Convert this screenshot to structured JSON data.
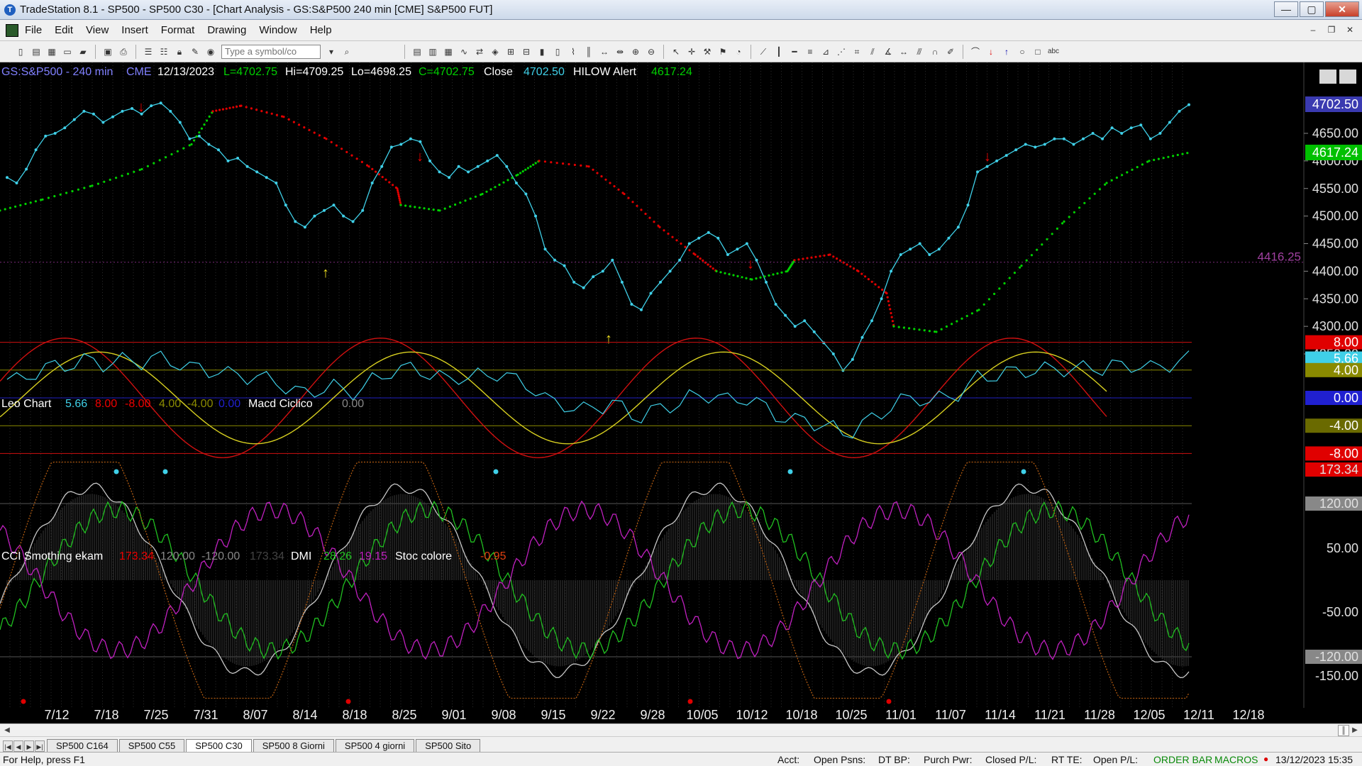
{
  "window": {
    "title": "TradeStation 8.1 - SP500 - SP500 C30 - [Chart Analysis - GS:S&P500  240 min  [CME] S&P500 FUT]",
    "app_icon": "tradestation-logo-icon"
  },
  "menu": [
    "File",
    "Edit",
    "View",
    "Insert",
    "Format",
    "Drawing",
    "Window",
    "Help"
  ],
  "toolbar": {
    "symbol_placeholder": "Type a symbol/co"
  },
  "chart": {
    "header": {
      "symbol": "GS:S&P500 - 240 min",
      "exchange": "CME",
      "date": "12/13/2023",
      "last": "L=4702.75",
      "high": "Hi=4709.25",
      "low": "Lo=4698.25",
      "close": "C=4702.75",
      "close_label": "Close",
      "close_value": "4702.50",
      "indicator": "HILOW Alert",
      "indicator_value": "4617.24"
    },
    "price_labels": {
      "last": "4702.50",
      "hilow": "4617.24",
      "hline": "4416.25"
    },
    "price_axis": [
      "4650.00",
      "4600.00",
      "4550.00",
      "4500.00",
      "4450.00",
      "4400.00",
      "4350.00",
      "4300.00",
      "4250.00"
    ],
    "price_axis_values": [
      4650,
      4600,
      4550,
      4500,
      4450,
      4400,
      4350,
      4300,
      4250
    ],
    "hline_value": 4416.25,
    "panel2": {
      "name": "Leo Chart",
      "v1": "5.66",
      "v2": "8.00",
      "v3": "-8.00",
      "v4": "4.00",
      "v5": "-4.00",
      "v6": "0.00",
      "name2": "Macd Ciclico",
      "v7": "0.00",
      "axis_labels": [
        "8.00",
        "5.66",
        "4.00",
        "0.00",
        "-4.00",
        "-8.00"
      ]
    },
    "panel3": {
      "name": "CCI Smothing ekam",
      "v1": "173.34",
      "v2": "120.00",
      "v3": "-120.00",
      "v4": "173.34",
      "name2": "DMI",
      "v5": "28.26",
      "v6": "19.15",
      "name3": "Stoc colore",
      "v7": "-0.95",
      "axis_labels": [
        "173.34",
        "120.00",
        "50.00",
        "-50.00",
        "-120.00",
        "-150.00"
      ]
    },
    "x_axis": [
      "7/12",
      "7/18",
      "7/25",
      "7/31",
      "8/07",
      "8/14",
      "8/18",
      "8/25",
      "9/01",
      "9/08",
      "9/15",
      "9/22",
      "9/28",
      "10/05",
      "10/12",
      "10/18",
      "10/25",
      "11/01",
      "11/07",
      "11/14",
      "11/21",
      "11/28",
      "12/05",
      "12/11",
      "12/18"
    ],
    "colors": {
      "price": "#3fd0e8",
      "hilow_up": "#00d000",
      "hilow_down": "#e00000",
      "leo_red": "#d01010",
      "leo_yellow": "#d8d020",
      "cci_white": "#c8c8c8",
      "dmi_green": "#20c020",
      "dmi_magenta": "#c020c0",
      "stoc_orange": "#b05a10"
    }
  },
  "tabs": [
    "SP500 C164",
    "SP500 C55",
    "SP500 C30",
    "SP500 8 Giorni",
    "SP500 4 giorni",
    "SP500 Sito"
  ],
  "active_tab": "SP500 C30",
  "status": {
    "help": "For Help, press F1",
    "acct": "Acct:",
    "open_psns": "Open Psns:",
    "dt_bp": "DT BP:",
    "purch_pwr": "Purch Pwr:",
    "closed_pl": "Closed P/L:",
    "rt_te": "RT TE:",
    "open_pl": "Open P/L:",
    "order_bar": "ORDER BAR",
    "macros": "MACROS",
    "datetime": "13/12/2023 15:35"
  }
}
